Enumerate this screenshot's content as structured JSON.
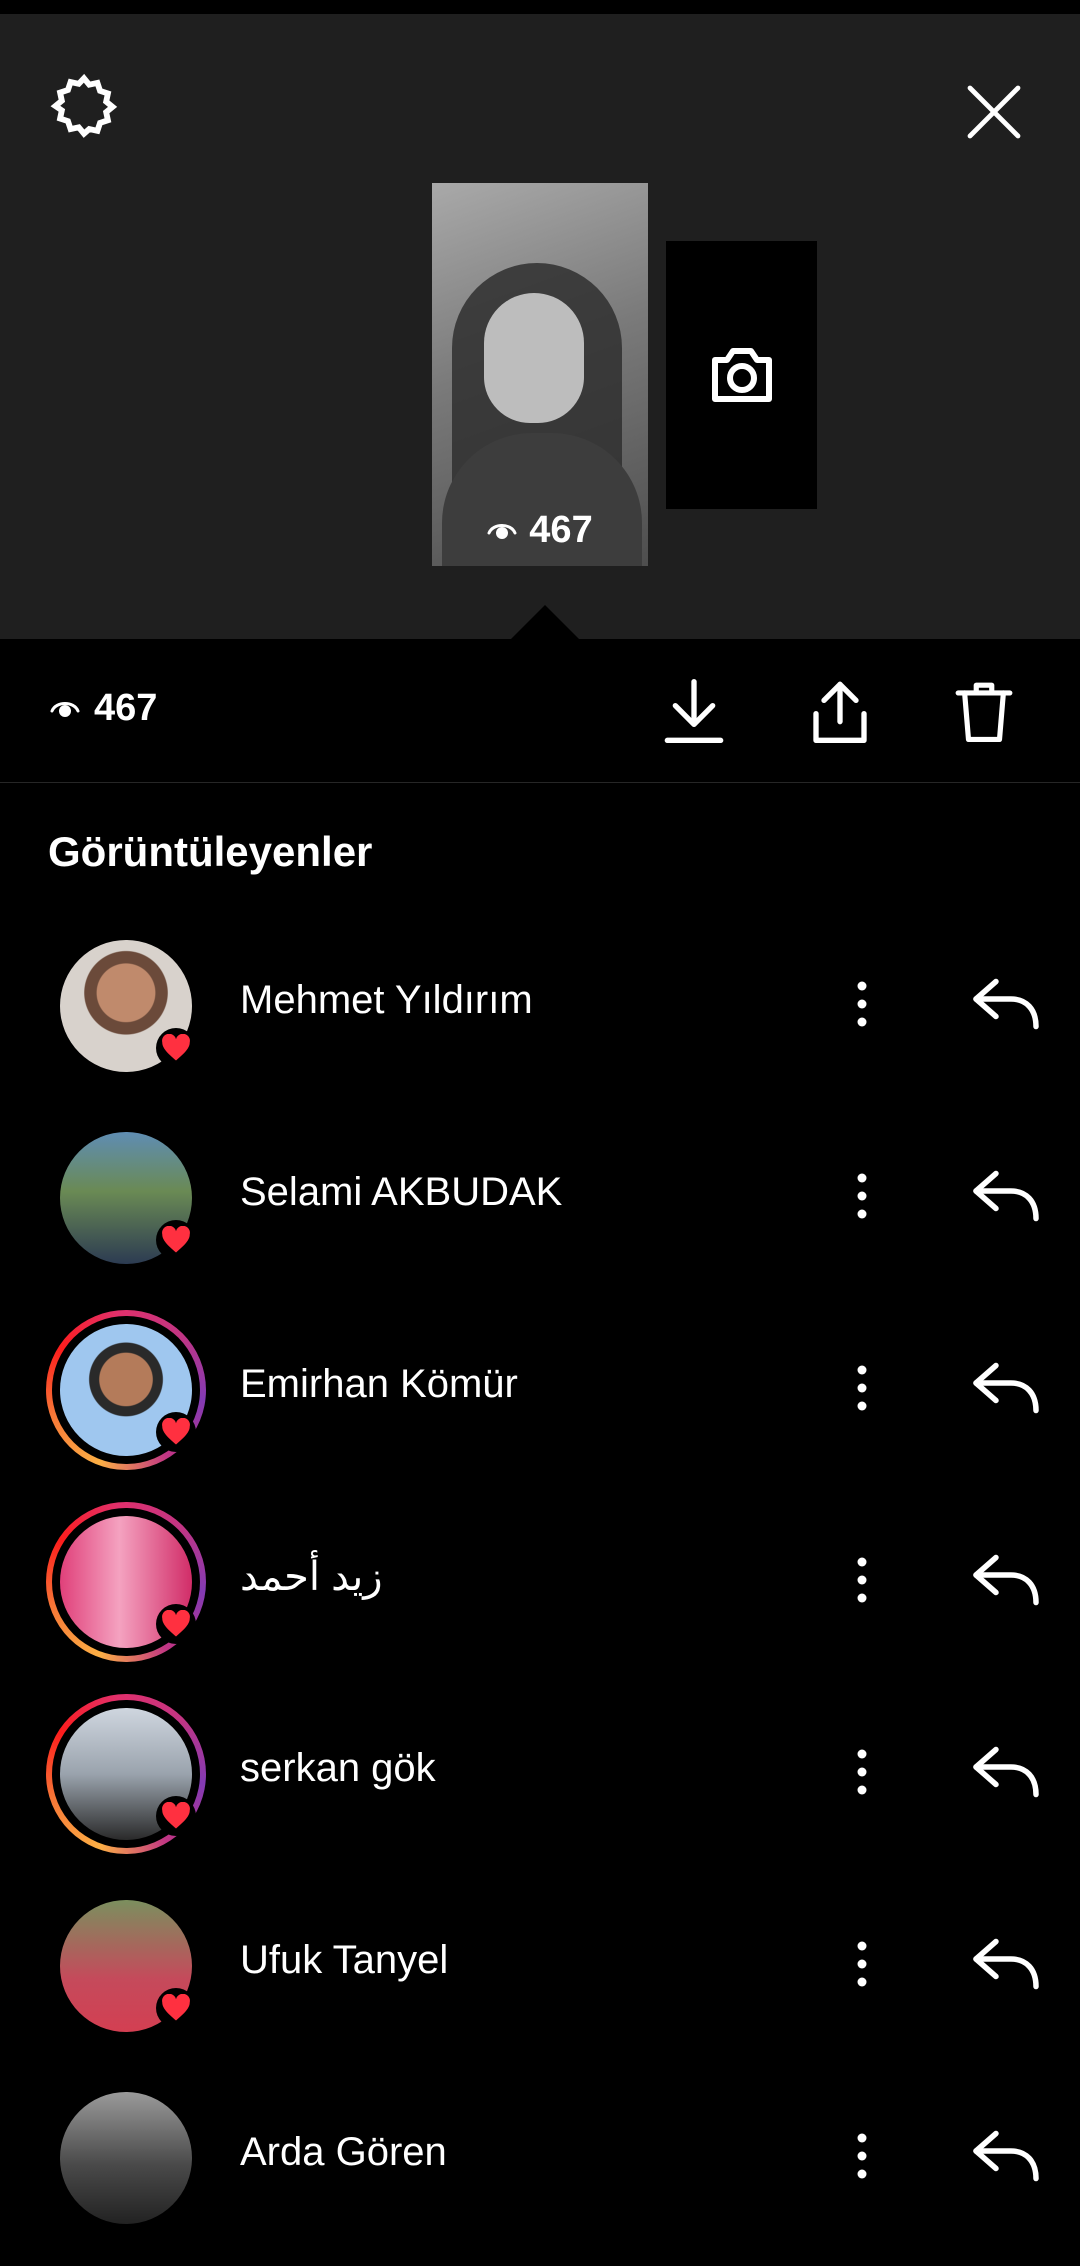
{
  "header": {
    "settings_icon": "gear-icon",
    "close_icon": "close-icon"
  },
  "story": {
    "view_count": "467",
    "add_story_icon": "camera-icon"
  },
  "toolbar": {
    "view_count": "467",
    "download_icon": "download-icon",
    "share_icon": "share-icon",
    "delete_icon": "trash-icon"
  },
  "viewers": {
    "heading": "Görüntüleyenler",
    "items": [
      {
        "name": "Mehmet Yıldırım",
        "has_story": false,
        "liked": true
      },
      {
        "name": "Selami AKBUDAK",
        "has_story": false,
        "liked": true
      },
      {
        "name": "Emirhan Kömür",
        "has_story": true,
        "liked": true
      },
      {
        "name": "زيد أحمد",
        "has_story": true,
        "liked": true
      },
      {
        "name": "serkan gök",
        "has_story": true,
        "liked": true
      },
      {
        "name": "Ufuk Tanyel",
        "has_story": false,
        "liked": true
      },
      {
        "name": "Arda Gören",
        "has_story": false,
        "liked": false
      }
    ]
  },
  "colors": {
    "heart": "#ff3040",
    "background": "#000000",
    "top_panel": "#1f1f1f"
  }
}
